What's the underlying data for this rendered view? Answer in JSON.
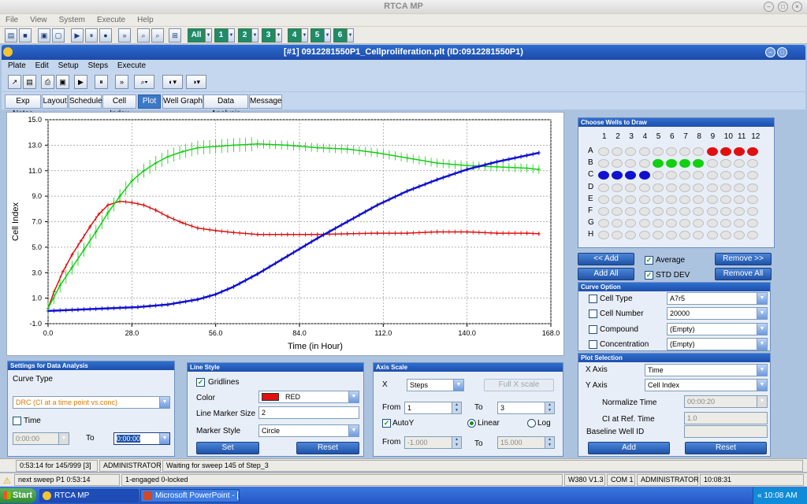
{
  "app": {
    "title": "RTCA MP"
  },
  "menu": [
    "File",
    "View",
    "System",
    "Execute",
    "Help"
  ],
  "toolbar": {
    "all_label": "All",
    "groups": [
      "1",
      "2",
      "3",
      "4",
      "5",
      "6"
    ]
  },
  "document": {
    "title": "[#1] 0912281550P1_Cellproliferation.plt (ID:0912281550P1)",
    "menu": [
      "Plate",
      "Edit",
      "Setup",
      "Steps",
      "Execute"
    ],
    "tabs": [
      "Exp Notes",
      "Layout",
      "Schedule",
      "Cell Index",
      "Plot",
      "Well Graph",
      "Data Analysis",
      "Message"
    ],
    "active_tab": "Plot"
  },
  "chart_data": {
    "type": "line",
    "xlabel": "Time (in Hour)",
    "ylabel": "Cell Index",
    "xlim": [
      0,
      168
    ],
    "ylim": [
      -1,
      15
    ],
    "xticks": [
      "0.0",
      "28.0",
      "56.0",
      "84.0",
      "112.0",
      "140.0",
      "168.0"
    ],
    "yticks": [
      "-1.0",
      "1.0",
      "3.0",
      "5.0",
      "7.0",
      "9.0",
      "11.0",
      "13.0",
      "15.0"
    ],
    "grid": true,
    "series": [
      {
        "color": "#e01010",
        "marker": "plus",
        "x": [
          0,
          2,
          5,
          8,
          11,
          14,
          17,
          20,
          24,
          28,
          32,
          36,
          40,
          45,
          50,
          56,
          62,
          70,
          80,
          90,
          100,
          110,
          120,
          130,
          140,
          150,
          160,
          164
        ],
        "y": [
          0.2,
          1.5,
          3.1,
          4.4,
          5.5,
          6.6,
          7.6,
          8.3,
          8.6,
          8.5,
          8.3,
          7.9,
          7.4,
          6.9,
          6.5,
          6.3,
          6.15,
          6.0,
          6.0,
          6.0,
          6.05,
          6.1,
          6.1,
          6.2,
          6.2,
          6.1,
          6.1,
          6.05
        ]
      },
      {
        "color": "#10d010",
        "marker": "plus",
        "x": [
          0,
          4,
          8,
          12,
          16,
          20,
          24,
          28,
          32,
          36,
          40,
          45,
          50,
          56,
          62,
          70,
          80,
          90,
          100,
          110,
          120,
          130,
          140,
          150,
          160,
          164
        ],
        "y": [
          0.2,
          2.0,
          3.4,
          4.8,
          6.2,
          7.7,
          9.0,
          10.2,
          11.0,
          11.6,
          12.1,
          12.5,
          12.8,
          12.9,
          13.0,
          13.1,
          13.0,
          12.8,
          12.7,
          12.4,
          12.0,
          11.6,
          11.4,
          11.3,
          11.2,
          11.1
        ]
      },
      {
        "color": "#1010d0",
        "marker": "plus",
        "x": [
          0,
          10,
          20,
          30,
          40,
          50,
          56,
          62,
          70,
          80,
          90,
          100,
          110,
          120,
          130,
          140,
          150,
          160,
          164
        ],
        "y": [
          0.0,
          0.1,
          0.2,
          0.3,
          0.5,
          0.9,
          1.3,
          1.9,
          2.9,
          4.3,
          5.7,
          7.0,
          8.3,
          9.4,
          10.3,
          11.1,
          11.7,
          12.2,
          12.4
        ]
      }
    ]
  },
  "wells": {
    "title": "Choose Wells to Draw",
    "columns": [
      "1",
      "2",
      "3",
      "4",
      "5",
      "6",
      "7",
      "8",
      "9",
      "10",
      "11",
      "12"
    ],
    "rows": [
      "A",
      "B",
      "C",
      "D",
      "E",
      "F",
      "G",
      "H"
    ],
    "selected": [
      {
        "row": "A",
        "cols": [
          9,
          10,
          11,
          12
        ],
        "color": "#e01010"
      },
      {
        "row": "B",
        "cols": [
          5,
          6,
          7,
          8
        ],
        "color": "#10d010"
      },
      {
        "row": "C",
        "cols": [
          1,
          2,
          3,
          4
        ],
        "color": "#1010d0"
      }
    ],
    "add_label": "<< Add",
    "add_all_label": "Add All",
    "remove_label": "Remove >>",
    "remove_all_label": "Remove All",
    "average_label": "Average",
    "stddev_label": "STD DEV"
  },
  "curve_option": {
    "title": "Curve Option",
    "cell_type_label": "Cell Type",
    "cell_type_value": "A7r5",
    "cell_number_label": "Cell Number",
    "cell_number_value": "20000",
    "compound_label": "Compound",
    "compound_value": "(Empty)",
    "concentration_label": "Concentration",
    "concentration_value": "(Empty)"
  },
  "plot_selection": {
    "title": "Plot Selection",
    "x_axis_label": "X Axis",
    "x_axis_value": "Time",
    "y_axis_label": "Y Axis",
    "y_axis_value": "Cell Index",
    "normalize_label": "Normalize Time",
    "normalize_value": "00:00:20",
    "ci_ref_label": "CI at Ref. Time",
    "ci_ref_value": "1.0",
    "baseline_label": "Baseline Well ID",
    "baseline_value": "",
    "add_label": "Add",
    "reset_label": "Reset"
  },
  "data_analysis": {
    "title": "Settings for Data Analysis",
    "curve_type_label": "Curve Type",
    "curve_type_value": "DRC (CI at a time point vs.conc)",
    "time_label": "Time",
    "time_from": "0:00:00",
    "to_label": "To",
    "time_to": "0:00:00"
  },
  "line_style": {
    "title": "Line Style",
    "gridlines_label": "Gridlines",
    "color_label": "Color",
    "color_value": "RED",
    "color_swatch": "#e01010",
    "marker_size_label": "Line Marker Size",
    "marker_size_value": "2",
    "marker_style_label": "Marker Style",
    "marker_style_value": "Circle",
    "set_label": "Set",
    "reset_label": "Reset"
  },
  "axis_scale": {
    "title": "Axis Scale",
    "x_label": "X",
    "x_value": "Steps",
    "full_x_label": "Full X scale",
    "from_label": "From",
    "from_value": "1",
    "to_label": "To",
    "to_value": "3",
    "autoy_label": "AutoY",
    "linear_label": "Linear",
    "log_label": "Log",
    "from2_label": "From",
    "from2_value": "-1.000",
    "to2_label": "To",
    "to2_value": "15.000"
  },
  "status1": {
    "time": "0:53:14 for 145/999 [3]",
    "user": "ADMINISTRATOR",
    "message": "Waiting for sweep 145 of Step_3"
  },
  "status2": {
    "sweep": "next sweep P1  0:53:14",
    "engaged": "1-engaged  0-locked",
    "version": "W380 V1.3",
    "com": "COM 1",
    "user": "ADMINISTRATOR",
    "time": "10:08:31"
  },
  "taskbar": {
    "start": "Start",
    "task1": "RTCA MP",
    "task2": "Microsoft PowerPoint - [...",
    "clock": "10:08 AM"
  }
}
